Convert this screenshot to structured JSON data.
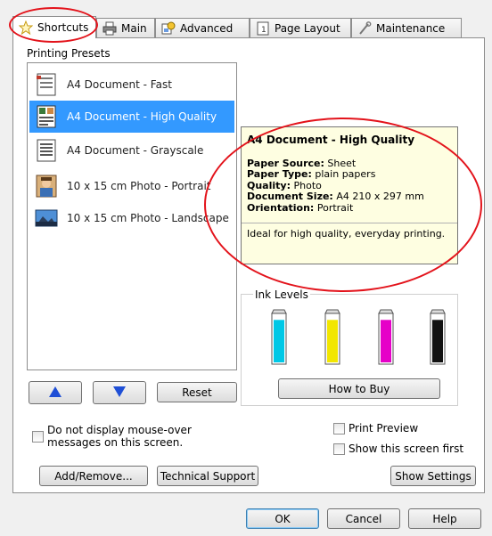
{
  "tabs": [
    {
      "label": "Shortcuts",
      "icon": "star-icon",
      "active": true
    },
    {
      "label": "Main",
      "icon": "printer-icon",
      "active": false
    },
    {
      "label": "Advanced",
      "icon": "advanced-icon",
      "active": false
    },
    {
      "label": "Page Layout",
      "icon": "page-layout-icon",
      "active": false
    },
    {
      "label": "Maintenance",
      "icon": "wrench-icon",
      "active": false
    }
  ],
  "presets": {
    "label": "Printing Presets",
    "items": [
      {
        "label": "A4 Document - Fast",
        "icon": "document-fast-icon",
        "selected": false
      },
      {
        "label": "A4 Document - High Quality",
        "icon": "document-high-quality-icon",
        "selected": true
      },
      {
        "label": "A4 Document - Grayscale",
        "icon": "document-grayscale-icon",
        "selected": false
      },
      {
        "label": "10 x 15 cm Photo - Portrait",
        "icon": "photo-portrait-icon",
        "selected": false
      },
      {
        "label": "10 x 15 cm Photo - Landscape",
        "icon": "photo-landscape-icon",
        "selected": false
      }
    ]
  },
  "tooltip": {
    "title": "A4 Document - High Quality",
    "rows": [
      {
        "key": "Paper Source:",
        "value": "Sheet"
      },
      {
        "key": "Paper Type:",
        "value": "plain papers"
      },
      {
        "key": "Quality:",
        "value": "Photo"
      },
      {
        "key": "Document Size:",
        "value": "A4 210 x 297 mm"
      },
      {
        "key": "Orientation:",
        "value": "Portrait"
      }
    ],
    "description": "Ideal for high quality, everyday printing."
  },
  "ink": {
    "label": "Ink Levels",
    "cartridges": [
      {
        "name": "cyan",
        "color": "#00c8e6",
        "level": 0.9
      },
      {
        "name": "yellow",
        "color": "#f2e600",
        "level": 0.9
      },
      {
        "name": "magenta",
        "color": "#e600c8",
        "level": 0.9
      },
      {
        "name": "black",
        "color": "#111111",
        "level": 0.9
      }
    ],
    "how_to_buy": "How to Buy"
  },
  "buttons": {
    "up": "up-arrow",
    "down": "down-arrow",
    "reset": "Reset",
    "add_remove": "Add/Remove...",
    "technical_support": "Technical Support",
    "show_settings": "Show Settings",
    "ok": "OK",
    "cancel": "Cancel",
    "help": "Help"
  },
  "checks": {
    "mouse_over": "Do not display mouse-over messages on this screen.",
    "print_preview": "Print Preview",
    "show_first": "Show this screen first"
  },
  "colors": {
    "selection": "#3399ff",
    "tooltip_bg": "#fefee1",
    "annotation": "#e3131b",
    "arrow_blue": "#1f4fd6"
  }
}
